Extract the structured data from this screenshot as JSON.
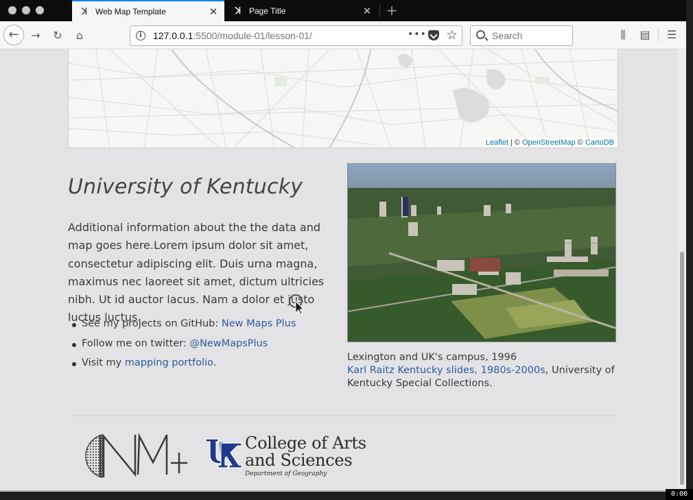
{
  "browser": {
    "tabs": [
      {
        "title": "Web Map Template",
        "icon": "uk-favicon",
        "active": true
      },
      {
        "title": "Page Title",
        "icon": "uk-favicon",
        "active": false
      }
    ],
    "url_host": "127.0.0.1",
    "url_rest": ":5500/module-01/lesson-01/",
    "search_placeholder": "Search",
    "accent": "#0a84ff"
  },
  "map": {
    "attribution": {
      "leaflet": "Leaflet",
      "sep1": " | © ",
      "osm": "OpenStreetMap",
      "sep2": " © ",
      "carto": "CartoDB"
    }
  },
  "content": {
    "title": "University of Kentucky",
    "intro": "Additional information about the the data and map goes here.Lorem ipsum dolor sit amet, consectetur adipiscing elit. Duis urna magna, maximus nec laoreet sit amet, dictum ultricies nibh. Ut id auctor lacus. Nam a dolor et justo luctus luctus.",
    "links": [
      {
        "prefix": "See my projects on GitHub: ",
        "link": "New Maps Plus",
        "suffix": ""
      },
      {
        "prefix": "Follow me on twitter: ",
        "link": "@NewMapsPlus",
        "suffix": ""
      },
      {
        "prefix": "Visit my ",
        "link": "mapping portfolio",
        "suffix": "."
      }
    ],
    "link_color": "#2f5a9e"
  },
  "photo": {
    "caption_line1": "Lexington and UK's campus, 1996",
    "caption_link": "Karl Raitz Kentucky slides, 1980s-2000s",
    "caption_rest": ", University of Kentucky Special Collections."
  },
  "footer": {
    "nm_logo_text": "NM+",
    "uk_logo_text": "UK",
    "college_line1": "College of Arts",
    "college_line2": "and Sciences",
    "department": "Department of Geography",
    "uk_blue": "#1e3a8a"
  },
  "recording": {
    "timer": "0:00"
  }
}
